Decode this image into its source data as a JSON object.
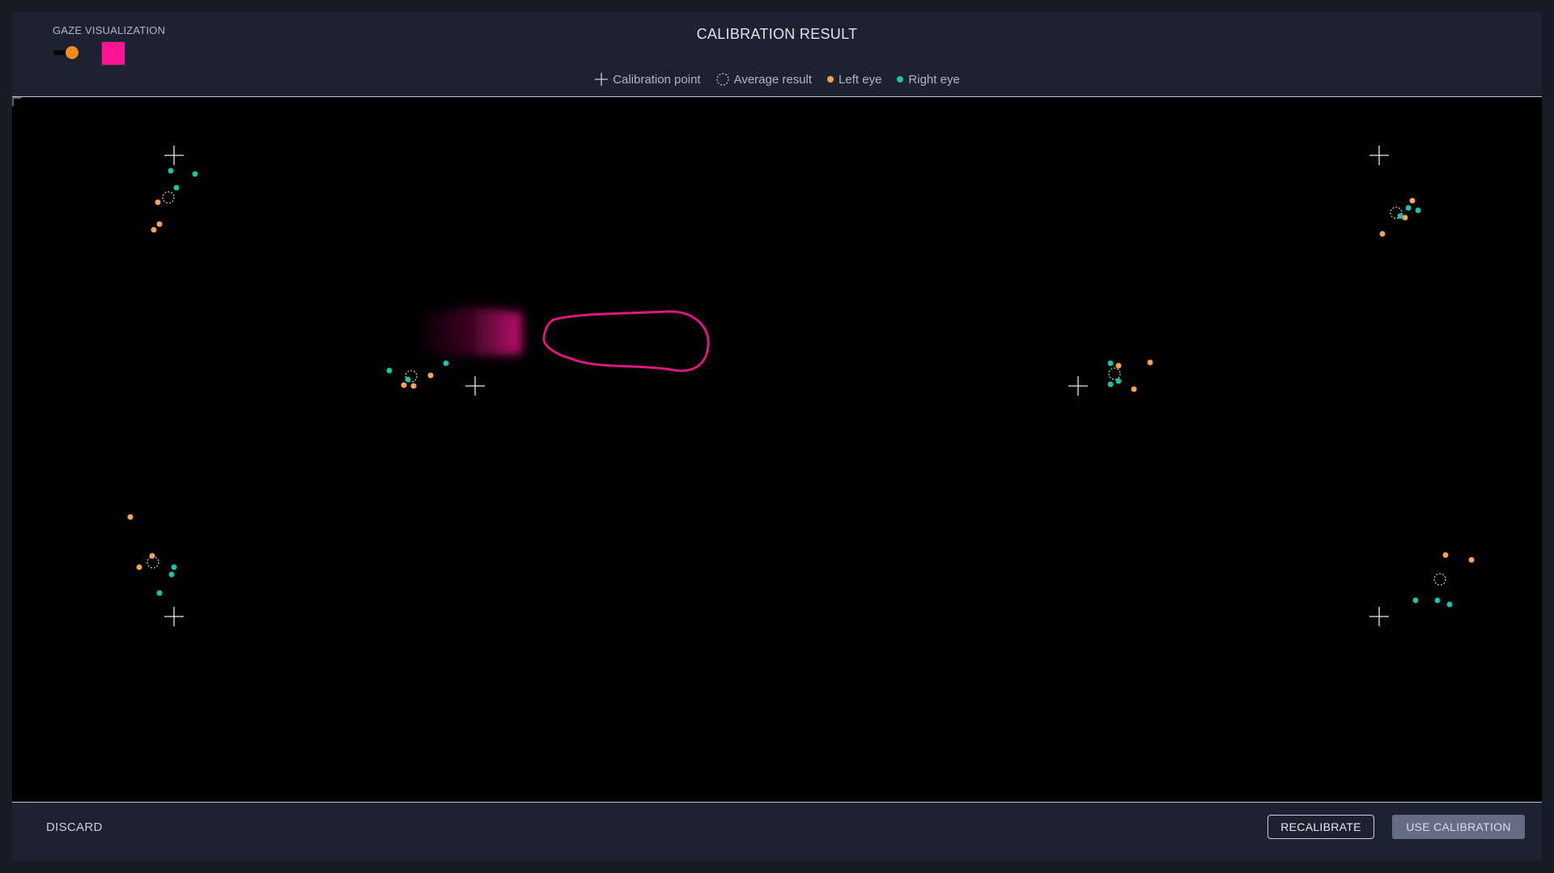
{
  "header": {
    "gaze_label": "GAZE VISUALIZATION",
    "title": "CALIBRATION RESULT",
    "toggle_on": true,
    "swatch_color": "#ff1493"
  },
  "legend": {
    "calibration_point": "Calibration point",
    "average_result": "Average result",
    "left_eye": "Left eye",
    "right_eye": "Right eye"
  },
  "colors": {
    "left_eye": "#f5a25d",
    "right_eye": "#20c0a6",
    "toggle_knob": "#f28c1f",
    "gaze_trail": "#ff1493"
  },
  "footer": {
    "discard_label": "DISCARD",
    "recalibrate_label": "RECALIBRATE",
    "use_label": "USE CALIBRATION"
  }
}
